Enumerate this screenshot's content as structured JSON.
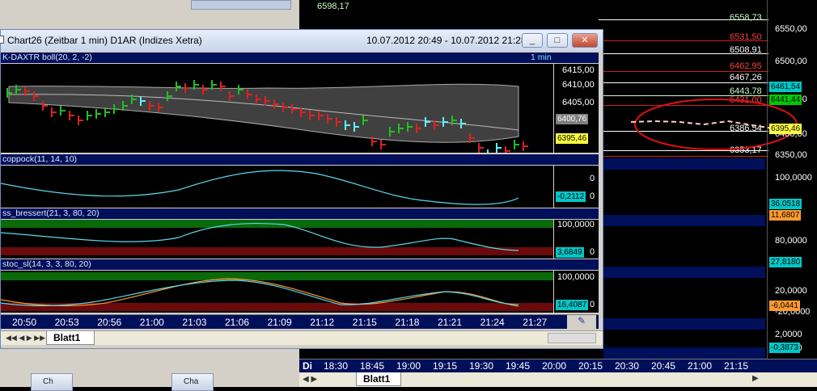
{
  "bg_chart": {
    "top_value": "6598,17",
    "right_scale": [
      "6550,00",
      "6500,00",
      "6450,00",
      "6400,00",
      "6350,00",
      "100,0000",
      "80,0000",
      "20,0000",
      "-20,0000",
      "2,0000",
      "0,0000"
    ],
    "price_labels": [
      {
        "text": "6558,73",
        "color": "#c8ffc8"
      },
      {
        "text": "6531,50",
        "color": "#ff4040"
      },
      {
        "text": "6508,91",
        "color": "#ffffff"
      },
      {
        "text": "6462,95",
        "color": "#ff4040"
      },
      {
        "text": "6467,26",
        "color": "#ffffff"
      },
      {
        "text": "6443,78",
        "color": "#c8ffc8"
      },
      {
        "text": "6431,00",
        "color": "#ff4040"
      },
      {
        "text": "6386,54",
        "color": "#ffffff"
      },
      {
        "text": "6353,17",
        "color": "#ffffff"
      }
    ],
    "tags": [
      {
        "text": "6461,54",
        "bg": "#00c8c8",
        "fg": "#000"
      },
      {
        "text": "6441,44",
        "bg": "#00c800",
        "fg": "#000"
      },
      {
        "text": "6395,46",
        "bg": "#ffff40",
        "fg": "#000"
      },
      {
        "text": "36,0518",
        "bg": "#00c8c8",
        "fg": "#000"
      },
      {
        "text": "11,6807",
        "bg": "#ff9a30",
        "fg": "#000"
      },
      {
        "text": "27,8180",
        "bg": "#00c8c8",
        "fg": "#000"
      },
      {
        "text": "-6,0441",
        "bg": "#ff9a30",
        "fg": "#000"
      },
      {
        "text": "-0,3873",
        "bg": "#00c8c8",
        "fg": "#000"
      }
    ],
    "time_axis_prefix": "Di",
    "time_axis": [
      "18:30",
      "18:45",
      "19:00",
      "19:15",
      "19:30",
      "19:45",
      "20:00",
      "20:15",
      "20:30",
      "20:45",
      "21:00",
      "21:15"
    ],
    "sheet_tab": "Blatt1"
  },
  "window": {
    "title": "Chart26 (Zeitbar 1 min)  D1AR (Indizes Xetra)",
    "date_range": "10.07.2012 20:49 - 10.07.2012 21:28",
    "min_label": "_",
    "max_label": "□",
    "close_label": "✕",
    "panes": [
      {
        "header": "K-DAXTR boll(20, 2, -2)",
        "right_header": "1 min"
      },
      {
        "header": "coppock(11, 14, 10)"
      },
      {
        "header": "ss_bressert(21, 3, 80, 20)"
      },
      {
        "header": "stoc_sl(14, 3, 3, 80, 20)"
      }
    ],
    "price_scale": [
      "6415,00",
      "6410,00",
      "6405,00",
      "6400,76",
      "6395,46"
    ],
    "coppock_scale": [
      "0",
      "-0,2112",
      "0"
    ],
    "bressert_scale": [
      "100,0000",
      "3,6849",
      "0"
    ],
    "stoc_scale": [
      "100,0000",
      "16,4087",
      "0"
    ],
    "time_axis": [
      "20:50",
      "20:53",
      "20:56",
      "21:00",
      "21:03",
      "21:06",
      "21:09",
      "21:12",
      "21:15",
      "21:18",
      "21:21",
      "21:24",
      "21:27"
    ],
    "sheet_tab": "Blatt1"
  },
  "taskbar": [
    "Ch",
    "Cha"
  ]
}
